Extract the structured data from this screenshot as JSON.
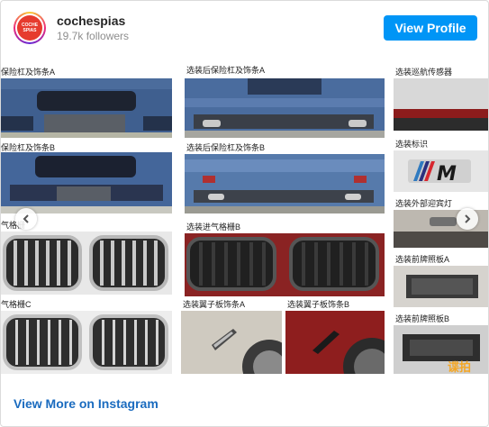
{
  "header": {
    "username": "cochespias",
    "followers": "19.7k followers",
    "view_profile": "View Profile",
    "avatar_text": "COCHE SPIAS"
  },
  "collage": {
    "captions": {
      "bumper_a": "保险杠及饰条A",
      "rear_bumper_a": "选装后保险杠及饰条A",
      "cruise_sensor": "选装巡航传感器",
      "bumper_b": "保险杠及饰条B",
      "rear_bumper_b": "选装后保险杠及饰条B",
      "badge": "选装标识",
      "welcome_light": "选装外部迎宾灯",
      "grille_a": "气格栅",
      "intake_grille_b": "选装进气格栅B",
      "plate_a": "选装前牌照板A",
      "grille_c": "气格栅C",
      "fender_trim_a": "选装翼子板饰条A",
      "fender_trim_b": "选装翼子板饰条B",
      "plate_b": "选装前牌照板B"
    },
    "watermark": "谍拍"
  },
  "footer": {
    "view_more": "View More on Instagram"
  },
  "colors": {
    "accent": "#0095f6",
    "link": "#1a6bbf",
    "car_blue": "#3f5f8f",
    "car_red": "#9e1c1c"
  }
}
